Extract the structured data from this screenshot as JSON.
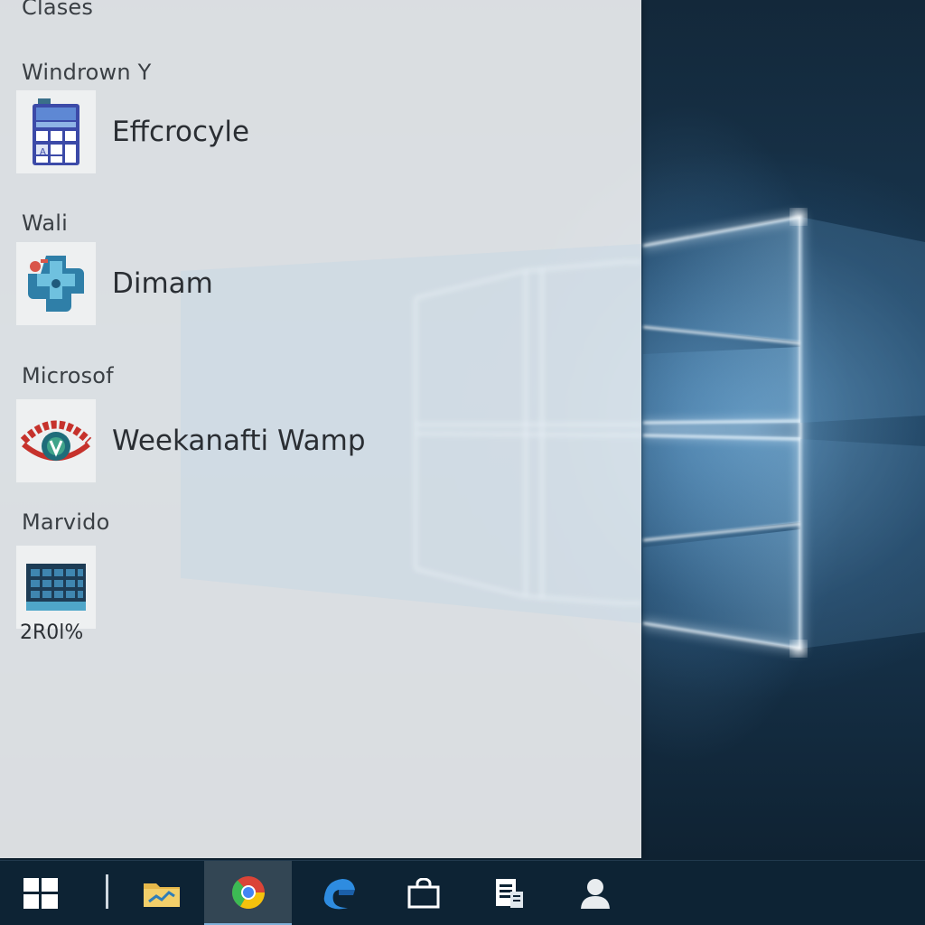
{
  "start_menu": {
    "header": "Clases",
    "groups": [
      {
        "label": "Windrown Y",
        "app": {
          "name": "Effcrocyle",
          "icon": "calculator-icon"
        }
      },
      {
        "label": "Wali",
        "app": {
          "name": "Dimam",
          "icon": "puzzle-icon"
        }
      },
      {
        "label": "Microsof",
        "app": {
          "name": "Weekanafti Wamp",
          "icon": "emblem-icon"
        }
      },
      {
        "label": "Marvido",
        "app": {
          "name": "",
          "icon": "grid-monitor-icon",
          "sub": "2R0l%"
        }
      }
    ]
  },
  "taskbar": {
    "items": [
      {
        "name": "start-button",
        "icon": "windows-logo-icon"
      },
      {
        "name": "file-explorer-button",
        "icon": "folder-icon"
      },
      {
        "name": "browser-button",
        "icon": "browser-icon",
        "active": true
      },
      {
        "name": "edge-button",
        "icon": "edge-icon"
      },
      {
        "name": "store-button",
        "icon": "bag-icon"
      },
      {
        "name": "documents-button",
        "icon": "document-icon"
      },
      {
        "name": "people-button",
        "icon": "person-icon"
      }
    ]
  },
  "colors": {
    "panel": "#e9ecee",
    "taskbar": "#0d2334",
    "accent": "#7fb0d8",
    "wallpaper_glow": "#78b4e1"
  }
}
